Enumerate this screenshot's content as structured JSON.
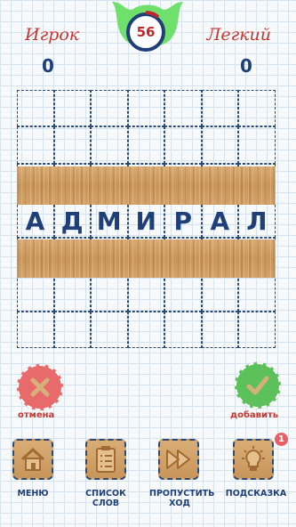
{
  "players": {
    "left": {
      "name": "Игрок",
      "score": "0"
    },
    "right": {
      "name": "Легкий",
      "score": "0"
    }
  },
  "timer": {
    "value": "56"
  },
  "board": {
    "rows": 7,
    "cols": 7,
    "word": [
      "А",
      "Д",
      "М",
      "И",
      "Р",
      "А",
      "Л"
    ]
  },
  "actions": {
    "cancel": {
      "label": "отмена",
      "icon": "cross-icon"
    },
    "add": {
      "label": "добавить",
      "icon": "check-icon"
    }
  },
  "toolbar": {
    "menu": {
      "label": "МЕНЮ",
      "icon": "house-icon"
    },
    "words": {
      "label_line1": "СПИСОК",
      "label_line2": "СЛОВ",
      "icon": "clipboard-list-icon"
    },
    "skip": {
      "label_line1": "ПРОПУСТИТЬ",
      "label_line2": "ХОД",
      "icon": "fast-forward-icon"
    },
    "hint": {
      "label": "ПОДСКАЗКА",
      "icon": "lightbulb-icon",
      "badge": "1"
    }
  },
  "colors": {
    "accent_red": "#c8352e",
    "navy": "#1f3f78",
    "green": "#5cc15a",
    "wood": "#c99559"
  }
}
